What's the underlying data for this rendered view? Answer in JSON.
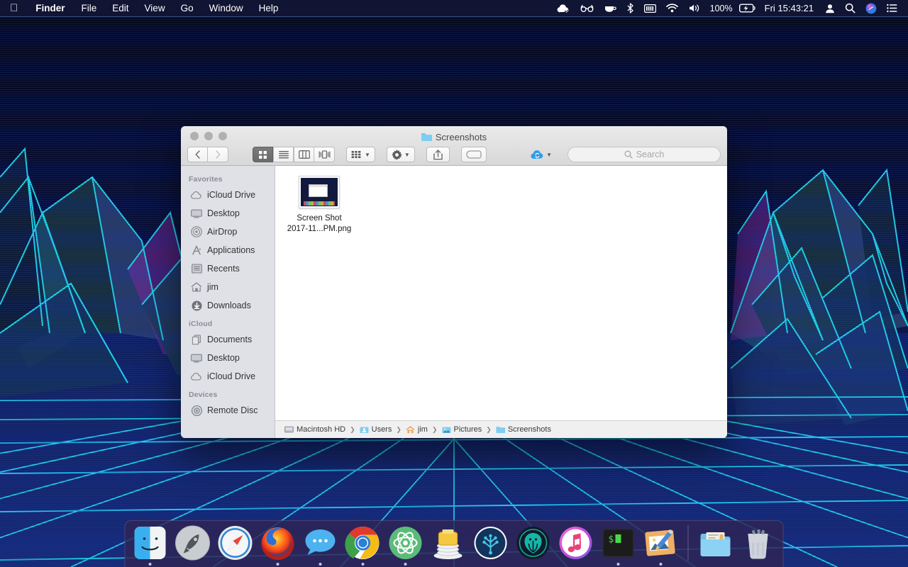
{
  "menubar": {
    "apple_icon": "apple-logo",
    "items": [
      {
        "label": "Finder",
        "bold": true
      },
      {
        "label": "File",
        "bold": false
      },
      {
        "label": "Edit",
        "bold": false
      },
      {
        "label": "View",
        "bold": false
      },
      {
        "label": "Go",
        "bold": false
      },
      {
        "label": "Window",
        "bold": false
      },
      {
        "label": "Help",
        "bold": false
      }
    ],
    "status": {
      "icons": [
        "cloud-check-icon",
        "glasses-icon",
        "coffee-cup-icon",
        "bluetooth-icon",
        "battery-bars-icon",
        "wifi-icon",
        "volume-icon"
      ],
      "battery_percent": "100%",
      "battery_icon": "battery-charging-icon",
      "clock": "Fri 15:43:21",
      "user_icon": "user-icon",
      "search_icon": "spotlight-search-icon",
      "siri_icon": "siri-icon",
      "notification_icon": "notification-center-icon"
    }
  },
  "finder": {
    "title": "Screenshots",
    "title_icon": "folder-icon",
    "traffic_lights": [
      "close-button",
      "minimize-button",
      "zoom-button"
    ],
    "toolbar": {
      "back_label": "‹",
      "forward_label": "›",
      "views": [
        {
          "name": "icon-view",
          "selected": true
        },
        {
          "name": "list-view",
          "selected": false
        },
        {
          "name": "column-view",
          "selected": false
        },
        {
          "name": "coverflow-view",
          "selected": false
        }
      ],
      "arrange_label": "arrange-by-icon",
      "action_label": "gear-icon",
      "share_label": "share-icon",
      "tag_label": "tag-icon",
      "cloud_label": "dropbox-sync-icon",
      "search_placeholder": "Search",
      "search_value": ""
    },
    "sidebar": {
      "sections": [
        {
          "title": "Favorites",
          "items": [
            {
              "label": "iCloud Drive",
              "icon": "cloud-icon"
            },
            {
              "label": "Desktop",
              "icon": "desktop-icon"
            },
            {
              "label": "AirDrop",
              "icon": "airdrop-icon"
            },
            {
              "label": "Applications",
              "icon": "applications-icon"
            },
            {
              "label": "Recents",
              "icon": "recents-icon"
            },
            {
              "label": "jim",
              "icon": "home-icon"
            },
            {
              "label": "Downloads",
              "icon": "downloads-icon"
            }
          ]
        },
        {
          "title": "iCloud",
          "items": [
            {
              "label": "Documents",
              "icon": "documents-icon"
            },
            {
              "label": "Desktop",
              "icon": "desktop-icon"
            },
            {
              "label": "iCloud Drive",
              "icon": "cloud-icon"
            }
          ]
        },
        {
          "title": "Devices",
          "items": [
            {
              "label": "Remote Disc",
              "icon": "disc-icon"
            }
          ]
        }
      ]
    },
    "files": [
      {
        "name_line1": "Screen Shot",
        "name_line2": "2017-11...PM.png",
        "icon": "png-thumbnail"
      }
    ],
    "pathbar": [
      {
        "label": "Macintosh HD",
        "icon": "harddisk-icon"
      },
      {
        "label": "Users",
        "icon": "users-folder-icon"
      },
      {
        "label": "jim",
        "icon": "home-folder-icon"
      },
      {
        "label": "Pictures",
        "icon": "pictures-folder-icon"
      },
      {
        "label": "Screenshots",
        "icon": "folder-icon"
      }
    ]
  },
  "dock": {
    "items": [
      {
        "name": "Finder",
        "icon": "finder-icon",
        "running": true
      },
      {
        "name": "Launchpad",
        "icon": "launchpad-icon",
        "running": false
      },
      {
        "name": "Safari",
        "icon": "safari-icon",
        "running": false
      },
      {
        "name": "Firefox",
        "icon": "firefox-icon",
        "running": true
      },
      {
        "name": "Messages",
        "icon": "messages-icon",
        "running": true
      },
      {
        "name": "Google Chrome",
        "icon": "chrome-icon",
        "running": true
      },
      {
        "name": "Atom",
        "icon": "atom-icon",
        "running": true
      },
      {
        "name": "Postgres",
        "icon": "postgres-icon",
        "running": false
      },
      {
        "name": "Sourcetree",
        "icon": "sourcetree-icon",
        "running": false
      },
      {
        "name": "GitKraken",
        "icon": "gitkraken-icon",
        "running": false
      },
      {
        "name": "iTunes",
        "icon": "itunes-icon",
        "running": false
      },
      {
        "name": "Terminal",
        "icon": "terminal-icon",
        "running": true
      },
      {
        "name": "Pixelmator",
        "icon": "pixelmator-icon",
        "running": true
      }
    ],
    "right_items": [
      {
        "name": "Documents Folder",
        "icon": "folder-stack-icon",
        "running": false
      },
      {
        "name": "Trash",
        "icon": "trash-icon",
        "running": false
      }
    ]
  },
  "colors": {
    "accent_cyan": "#22e0f5",
    "wallpaper_base": "#060a24",
    "dock_bg": "rgba(46,37,84,0.82)",
    "menubar_bg": "rgba(18,22,52,0.92)"
  }
}
